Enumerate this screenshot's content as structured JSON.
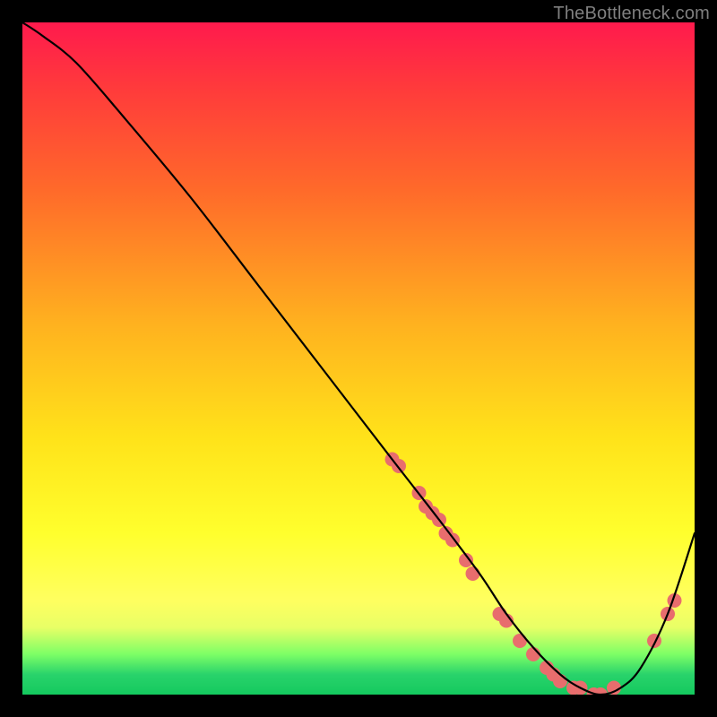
{
  "watermark": "TheBottleneck.com",
  "chart_data": {
    "type": "line",
    "title": "",
    "xlabel": "",
    "ylabel": "",
    "xlim": [
      0,
      100
    ],
    "ylim": [
      0,
      100
    ],
    "grid": false,
    "legend": false,
    "series": [
      {
        "name": "bottleneck-curve",
        "color": "#000000",
        "x": [
          0,
          3,
          8,
          15,
          25,
          35,
          45,
          55,
          62,
          68,
          72,
          76,
          80,
          83,
          86,
          89,
          92,
          96,
          100
        ],
        "y": [
          100,
          98,
          94,
          86,
          74,
          61,
          48,
          35,
          26,
          18,
          12,
          7,
          3,
          1,
          0,
          1,
          4,
          12,
          24
        ]
      }
    ],
    "annotations": {
      "scatter_points": {
        "color": "#e86d6d",
        "radius": 8,
        "points": [
          {
            "x": 55,
            "y": 35
          },
          {
            "x": 56,
            "y": 34
          },
          {
            "x": 59,
            "y": 30
          },
          {
            "x": 60,
            "y": 28
          },
          {
            "x": 61,
            "y": 27
          },
          {
            "x": 62,
            "y": 26
          },
          {
            "x": 63,
            "y": 24
          },
          {
            "x": 64,
            "y": 23
          },
          {
            "x": 66,
            "y": 20
          },
          {
            "x": 67,
            "y": 18
          },
          {
            "x": 71,
            "y": 12
          },
          {
            "x": 72,
            "y": 11
          },
          {
            "x": 74,
            "y": 8
          },
          {
            "x": 76,
            "y": 6
          },
          {
            "x": 78,
            "y": 4
          },
          {
            "x": 79,
            "y": 3
          },
          {
            "x": 80,
            "y": 2
          },
          {
            "x": 82,
            "y": 1
          },
          {
            "x": 83,
            "y": 1
          },
          {
            "x": 85,
            "y": 0
          },
          {
            "x": 86,
            "y": 0
          },
          {
            "x": 88,
            "y": 1
          },
          {
            "x": 94,
            "y": 8
          },
          {
            "x": 96,
            "y": 12
          },
          {
            "x": 97,
            "y": 14
          }
        ]
      }
    }
  }
}
